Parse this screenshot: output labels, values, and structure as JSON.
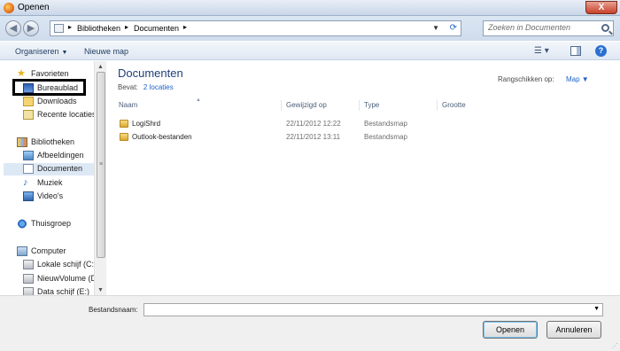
{
  "window": {
    "title": "Openen",
    "close_label": "X"
  },
  "address": {
    "crumbs": [
      "Bibliotheken",
      "Documenten"
    ],
    "separator": "▸",
    "search_placeholder": "Zoeken in Documenten"
  },
  "toolbar": {
    "organize_label": "Organiseren",
    "new_folder_label": "Nieuwe map",
    "help_label": "?"
  },
  "navpane": {
    "favorites": {
      "label": "Favorieten",
      "items": [
        "Bureaublad",
        "Downloads",
        "Recente locaties"
      ]
    },
    "libraries": {
      "label": "Bibliotheken",
      "items": [
        "Afbeeldingen",
        "Documenten",
        "Muziek",
        "Video's"
      ],
      "selected": "Documenten"
    },
    "homegroup": {
      "label": "Thuisgroep"
    },
    "computer": {
      "label": "Computer",
      "items": [
        "Lokale schijf (C:)",
        "NieuwVolume (D",
        "Data schijf (E:)"
      ]
    }
  },
  "content": {
    "title": "Documenten",
    "contains_label": "Bevat:",
    "contains_link": "2 locaties",
    "arrange_label": "Rangschikken op:",
    "arrange_value": "Map",
    "columns": [
      "Naam",
      "Gewijzigd op",
      "Type",
      "Grootte"
    ],
    "rows": [
      {
        "name": "LogiShrd",
        "date": "22/11/2012 12:22",
        "type": "Bestandsmap",
        "size": ""
      },
      {
        "name": "Outlook-bestanden",
        "date": "22/11/2012 13:11",
        "type": "Bestandsmap",
        "size": ""
      }
    ]
  },
  "bottom": {
    "filename_label": "Bestandsnaam:",
    "filename_value": "",
    "open_label": "Openen",
    "cancel_label": "Annuleren"
  },
  "colors": {
    "title_blue": "#1e3f7a",
    "link_blue": "#1f63c6",
    "selection": "#dde8f5"
  }
}
